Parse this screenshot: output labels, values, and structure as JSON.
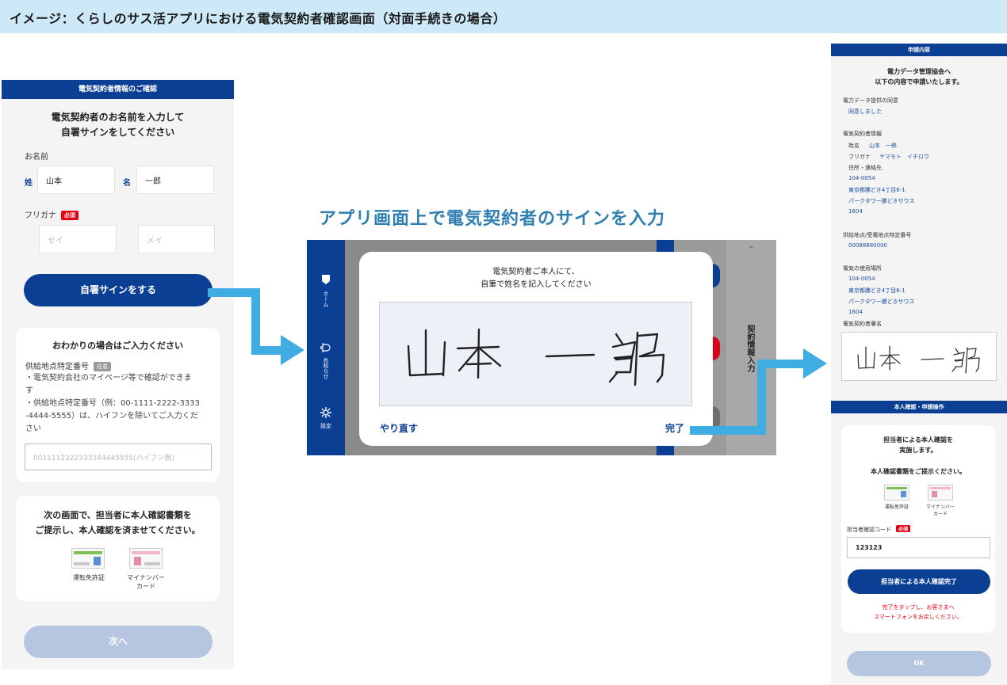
{
  "banner": {
    "text": "イメージ：くらしのサス活アプリにおける電気契約者確認画面（対面手続きの場合）"
  },
  "left": {
    "header": "電気契約者情報のご確認",
    "title_line1": "電気契約者のお名前を入力して",
    "title_line2": "自署サインをしてください",
    "name_label": "お名前",
    "sei_label": "姓",
    "sei_value": "山本",
    "mei_label": "名",
    "mei_value": "一郎",
    "kana_label": "フリガナ",
    "required": "必須",
    "kana_sei_placeholder": "セイ",
    "kana_mei_placeholder": "メイ",
    "sign_button": "自署サインをする",
    "optional_card": {
      "title": "おわかりの場合はご入力ください",
      "field_label": "供給地点特定番号",
      "optional": "任意",
      "note_line1": "・電気契約会社のマイページ等で確認ができま",
      "note_line2": "す",
      "note_line3": "・供給地点特定番号（例：00-1111-2222-3333",
      "note_line4": "-4444-5555）は、ハイフンを除いてご入力くだ",
      "note_line5": "さい",
      "placeholder": "0011112222333344445555(ハイフン無)"
    },
    "id_card": {
      "line1": "次の画面で、担当者に本人確認書類を",
      "line2": "ご提示し、本人確認を済ませてください。",
      "license": "運転免許証",
      "mynumber_line1": "マイナンバー",
      "mynumber_line2": "カード"
    },
    "next_button": "次へ"
  },
  "middle": {
    "heading": "アプリ画面上で電気契約者のサインを入力",
    "side_home": "ホーム",
    "side_notice": "お知らせ",
    "side_settings": "設定",
    "side_right_label": "契約情報入力",
    "modal_line1": "電気契約者ご本人にて、",
    "modal_line2": "自筆で姓名を記入してください",
    "redo_button": "やり直す",
    "done_button": "完了"
  },
  "right": {
    "header1": "申請内容",
    "intro_line1": "電力データ管理協会へ",
    "intro_line2": "以下の内容で申請いたします。",
    "provide_label": "電力データ提供の同意",
    "provide_value": "同意しました",
    "contractor_label": "電気契約者情報",
    "name_key": "姓名",
    "name_value": "山本　一郎",
    "kana_key": "フリガナ",
    "kana_value": "ヤマモト　イチロウ",
    "address_key": "住所・連絡先",
    "addr1": "104-0054",
    "addr2": "東京都勝どき4丁目6-1",
    "addr3": "パークタワー勝どきサウス",
    "addr4": "1604",
    "supply_label": "供給地点/受電地点特定番号",
    "supply_value": "00088880000",
    "usage_label": "電気の使用場所",
    "usage1": "104-0054",
    "usage2": "東京都勝どき4丁目6-1",
    "usage3": "パークタワー勝どきサウス",
    "usage4": "1604",
    "signature_label": "電気契約者署名",
    "header2": "本人確認・申請操作",
    "verify_line1": "担当者による本人確認を",
    "verify_line2": "実施します。",
    "present_text": "本人確認書類をご提示ください。",
    "license": "運転免許証",
    "mynumber_line1": "マイナンバー",
    "mynumber_line2": "カード",
    "code_label": "担当者確認コード",
    "required": "必須",
    "code_value": "123123",
    "verify_button": "担当者による本人確認完了",
    "red_line1": "完了をタップし、お客さまへ",
    "red_line2": "スマートフォンをお戻しください。",
    "ok_button": "OK"
  },
  "colors": {
    "navy": "#0b3f94",
    "arrow": "#40ade2",
    "banner": "#cde9f7",
    "disabled": "#b6c5e0",
    "required": "#e60012"
  }
}
